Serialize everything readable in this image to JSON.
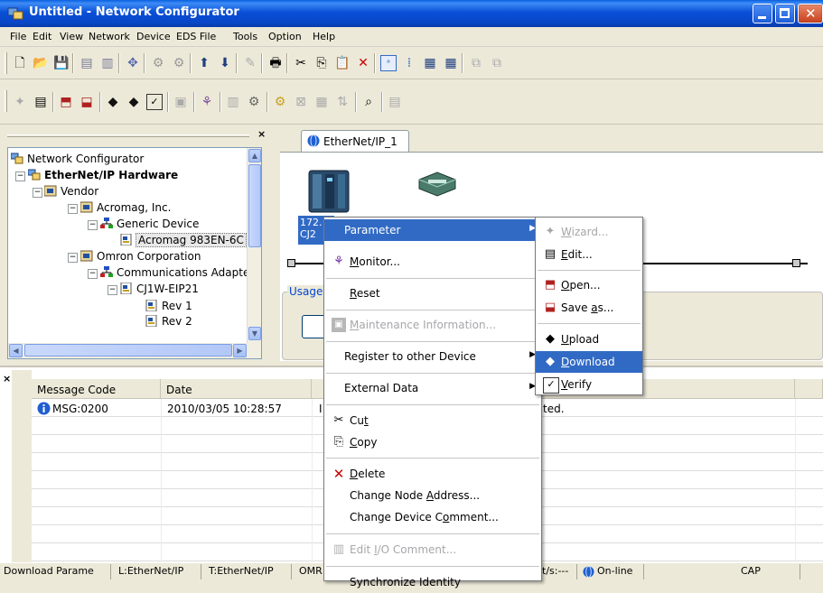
{
  "window": {
    "title": "Untitled - Network Configurator"
  },
  "menubar": [
    "File",
    "Edit",
    "View",
    "Network",
    "Device",
    "EDS File",
    "Tools",
    "Option",
    "Help"
  ],
  "tree": {
    "items": [
      {
        "label": "Network Configurator"
      },
      {
        "label": "EtherNet/IP Hardware"
      },
      {
        "label": "Vendor"
      },
      {
        "label": "Acromag, Inc."
      },
      {
        "label": "Generic Device"
      },
      {
        "label": "Acromag 983EN-6C"
      },
      {
        "label": "Omron Corporation"
      },
      {
        "label": "Communications Adapte"
      },
      {
        "label": "CJ1W-EIP21"
      },
      {
        "label": "Rev 1"
      },
      {
        "label": "Rev 2"
      }
    ]
  },
  "tab": {
    "label": "EtherNet/IP_1"
  },
  "canvas": {
    "device_ip": "172.",
    "device_model": "CJ2",
    "usage_label": "Usage"
  },
  "log": {
    "headers": [
      "Message Code",
      "Date"
    ],
    "rows": [
      {
        "code": "MSG:0200",
        "date": "2010/03/05 10:28:57",
        "col3": "I",
        "msg_tail": "ted."
      }
    ]
  },
  "context_menu": {
    "items": [
      {
        "label": "Parameter",
        "submenu": true,
        "selected": true
      },
      {
        "label": "Monitor...",
        "u": "M"
      },
      {
        "label": "Reset",
        "u": "R"
      },
      {
        "label": "Maintenance Information...",
        "u": "M",
        "disabled": true
      },
      {
        "label": "Register to other Device",
        "submenu": true
      },
      {
        "label": "External Data",
        "submenu": true
      },
      {
        "label": "Cut",
        "u": "t"
      },
      {
        "label": "Copy",
        "u": "C"
      },
      {
        "label": "Delete",
        "u": "D"
      },
      {
        "label": "Change Node Address...",
        "u": "A"
      },
      {
        "label": "Change Device Comment...",
        "u": "o"
      },
      {
        "label": "Edit I/O Comment...",
        "u": "I",
        "disabled": true
      },
      {
        "label": "Synchronize Identity"
      }
    ]
  },
  "parameter_submenu": {
    "items": [
      {
        "label": "Wizard...",
        "disabled": true
      },
      {
        "label": "Edit..."
      },
      {
        "label": "Open..."
      },
      {
        "label": "Save as..."
      },
      {
        "label": "Upload"
      },
      {
        "label": "Download",
        "selected": true
      },
      {
        "label": "Verify"
      }
    ]
  },
  "statusbar": {
    "cells": [
      "Download Parame",
      "L:EtherNet/IP",
      "T:EtherNet/IP",
      "OMR"
    ],
    "right_cells": [
      "t/s:---",
      "On-line",
      "CAP"
    ]
  }
}
